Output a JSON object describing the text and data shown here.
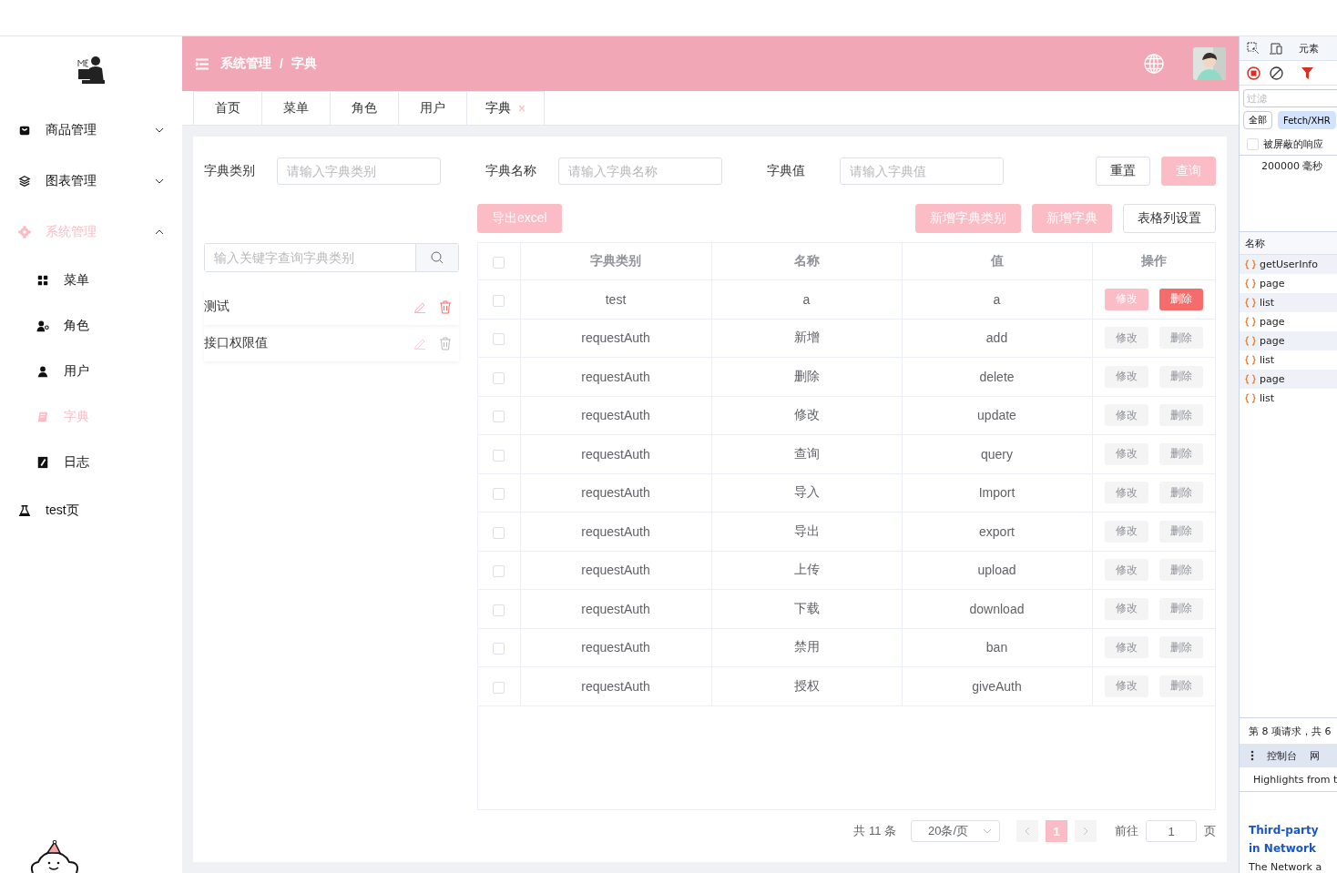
{
  "sidebar": {
    "items": [
      {
        "label": "商品管理",
        "expanded": false,
        "selected": false
      },
      {
        "label": "图表管理",
        "expanded": false,
        "selected": false
      },
      {
        "label": "系统管理",
        "expanded": true,
        "selected": true,
        "children": [
          {
            "label": "菜单",
            "selected": false
          },
          {
            "label": "角色",
            "selected": false
          },
          {
            "label": "用户",
            "selected": false
          },
          {
            "label": "字典",
            "selected": true
          },
          {
            "label": "日志",
            "selected": false
          }
        ]
      },
      {
        "label": "test页",
        "selected": false
      }
    ]
  },
  "header": {
    "breadcrumb": [
      "系统管理",
      "字典"
    ],
    "separator": "/"
  },
  "tabs": [
    {
      "label": "首页",
      "selected": false
    },
    {
      "label": "菜单",
      "selected": false
    },
    {
      "label": "角色",
      "selected": false
    },
    {
      "label": "用户",
      "selected": false
    },
    {
      "label": "字典",
      "selected": true
    }
  ],
  "filters": [
    {
      "label": "字典类别",
      "placeholder": "请输入字典类别"
    },
    {
      "label": "字典名称",
      "placeholder": "请输入字典名称"
    },
    {
      "label": "字典值",
      "placeholder": "请输入字典值"
    }
  ],
  "filter_buttons": [
    {
      "label": "重置",
      "kind": "plain"
    },
    {
      "label": "查询",
      "kind": "primary"
    }
  ],
  "toolbar": {
    "left": [
      {
        "label": "导出excel",
        "kind": "primary"
      }
    ],
    "right": [
      {
        "label": "新增字典类别",
        "kind": "primary"
      },
      {
        "label": "新增字典",
        "kind": "primary"
      },
      {
        "label": "表格列设置",
        "kind": "plain"
      }
    ]
  },
  "category_panel": {
    "search_placeholder": "输入关键字查询字典类别",
    "items": [
      {
        "label": "测试",
        "selected": true
      },
      {
        "label": "接口权限值",
        "selected": false
      }
    ]
  },
  "table": {
    "all_checked": false,
    "columns": [
      "字典类别",
      "名称",
      "值",
      "操作"
    ],
    "rows": [
      {
        "checked": false,
        "cells": [
          "test",
          "a",
          "a"
        ],
        "actions": [
          "修改",
          "删除"
        ],
        "disabled": false
      },
      {
        "checked": false,
        "cells": [
          "requestAuth",
          "新增",
          "add"
        ],
        "actions": [
          "修改",
          "删除"
        ],
        "disabled": true
      },
      {
        "checked": false,
        "cells": [
          "requestAuth",
          "删除",
          "delete"
        ],
        "actions": [
          "修改",
          "删除"
        ],
        "disabled": true
      },
      {
        "checked": false,
        "cells": [
          "requestAuth",
          "修改",
          "update"
        ],
        "actions": [
          "修改",
          "删除"
        ],
        "disabled": true
      },
      {
        "checked": false,
        "cells": [
          "requestAuth",
          "查询",
          "query"
        ],
        "actions": [
          "修改",
          "删除"
        ],
        "disabled": true
      },
      {
        "checked": false,
        "cells": [
          "requestAuth",
          "导入",
          "Import"
        ],
        "actions": [
          "修改",
          "删除"
        ],
        "disabled": true
      },
      {
        "checked": false,
        "cells": [
          "requestAuth",
          "导出",
          "export"
        ],
        "actions": [
          "修改",
          "删除"
        ],
        "disabled": true
      },
      {
        "checked": false,
        "cells": [
          "requestAuth",
          "上传",
          "upload"
        ],
        "actions": [
          "修改",
          "删除"
        ],
        "disabled": true
      },
      {
        "checked": false,
        "cells": [
          "requestAuth",
          "下载",
          "download"
        ],
        "actions": [
          "修改",
          "删除"
        ],
        "disabled": true
      },
      {
        "checked": false,
        "cells": [
          "requestAuth",
          "禁用",
          "ban"
        ],
        "actions": [
          "修改",
          "删除"
        ],
        "disabled": true
      },
      {
        "checked": false,
        "cells": [
          "requestAuth",
          "授权",
          "giveAuth"
        ],
        "actions": [
          "修改",
          "删除"
        ],
        "disabled": true
      }
    ]
  },
  "pagination": {
    "total": "共 11 条",
    "page_size": "20条/页",
    "pages": [
      {
        "label": "1",
        "selected": true
      }
    ],
    "goto_label": "前往",
    "goto_value": "1",
    "goto_suffix": "页"
  },
  "devtools": {
    "tab": "元素",
    "filter_placeholder": "过滤",
    "chips": [
      {
        "label": "全部",
        "selected": false
      },
      {
        "label": "Fetch/XHR",
        "selected": true
      }
    ],
    "blocked": {
      "label": "被屏蔽的响应",
      "checked": false
    },
    "timeline_label": "200000 毫秒",
    "name_header": "名称",
    "requests": [
      "getUserInfo",
      "page",
      "list",
      "page",
      "page",
      "list",
      "page",
      "list"
    ],
    "status": "第 8 项请求，共 6",
    "drawer_tabs": [
      "控制台",
      "网"
    ],
    "highlights": "Highlights from t",
    "headline": [
      "Third-party",
      "in Network"
    ],
    "body": "The Network a"
  }
}
